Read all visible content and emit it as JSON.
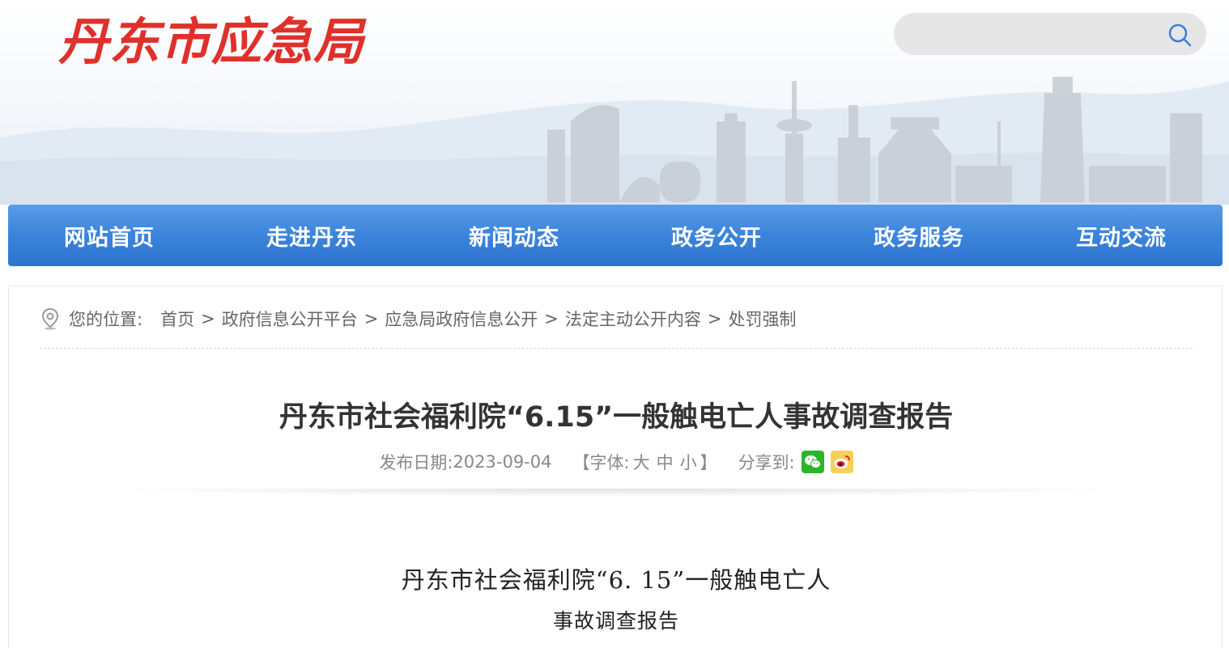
{
  "header": {
    "site_name": "丹东市应急局",
    "search": {
      "placeholder": "",
      "value": ""
    }
  },
  "nav": {
    "items": [
      {
        "label": "网站首页"
      },
      {
        "label": "走进丹东"
      },
      {
        "label": "新闻动态"
      },
      {
        "label": "政务公开"
      },
      {
        "label": "政务服务"
      },
      {
        "label": "互动交流"
      }
    ]
  },
  "breadcrumb": {
    "prefix": "您的位置:",
    "items": [
      "首页",
      "政府信息公开平台",
      "应急局政府信息公开",
      "法定主动公开内容",
      "处罚强制"
    ],
    "separator": ">"
  },
  "article": {
    "title": "丹东市社会福利院“6.15”一般触电亡人事故调查报告",
    "date_label": "发布日期:",
    "date": "2023-09-04",
    "font_open": "【字体:",
    "font_large": "大",
    "font_medium": "中",
    "font_small": "小",
    "font_close": "】",
    "share_label": "分享到:",
    "share_icons": [
      "wechat-icon",
      "weibo-icon"
    ],
    "doc_title_line1": "丹东市社会福利院“6. 15”一般触电亡人",
    "doc_title_line2": "事故调查报告"
  },
  "colors": {
    "logo_red": "#e0302a",
    "nav_blue": "#3d86dc",
    "wechat_green": "#2db52a",
    "weibo_yellow": "#f6d15a"
  }
}
